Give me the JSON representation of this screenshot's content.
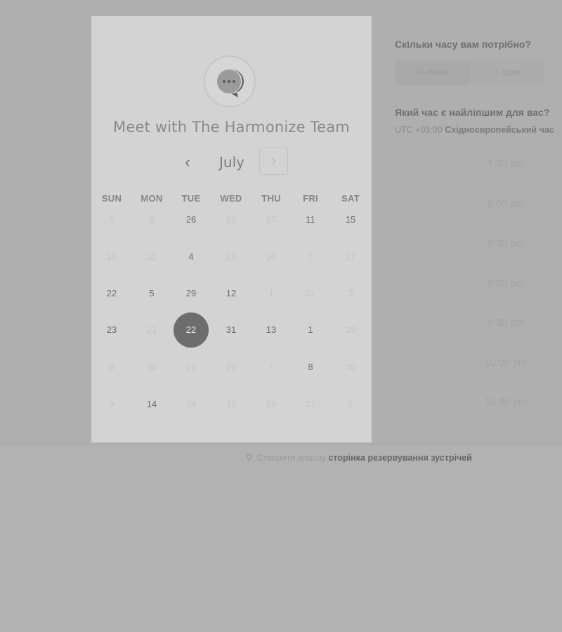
{
  "calendar": {
    "title": "Meet with The Harmonize Team",
    "month": "July",
    "prev_label": "‹",
    "next_label": "›",
    "logo_icon": "chat-bubble-icon",
    "weekdays": [
      "SUN",
      "MON",
      "TUE",
      "WED",
      "THU",
      "FRI",
      "SAT"
    ],
    "weeks": [
      [
        {
          "d": "5",
          "on": false
        },
        {
          "d": "8",
          "on": false
        },
        {
          "d": "26",
          "on": true
        },
        {
          "d": "10",
          "on": false
        },
        {
          "d": "27",
          "on": false
        },
        {
          "d": "11",
          "on": true
        },
        {
          "d": "15",
          "on": true
        }
      ],
      [
        {
          "d": "18",
          "on": false
        },
        {
          "d": "11",
          "on": false
        },
        {
          "d": "4",
          "on": true
        },
        {
          "d": "21",
          "on": false
        },
        {
          "d": "20",
          "on": false
        },
        {
          "d": "7",
          "on": false
        },
        {
          "d": "17",
          "on": false
        }
      ],
      [
        {
          "d": "22",
          "on": true
        },
        {
          "d": "5",
          "on": true
        },
        {
          "d": "29",
          "on": true
        },
        {
          "d": "12",
          "on": true
        },
        {
          "d": "1",
          "on": false
        },
        {
          "d": "11",
          "on": false
        },
        {
          "d": "3",
          "on": false
        }
      ],
      [
        {
          "d": "23",
          "on": true
        },
        {
          "d": "21",
          "on": false
        },
        {
          "d": "22",
          "on": true,
          "selected": true
        },
        {
          "d": "31",
          "on": true
        },
        {
          "d": "13",
          "on": true
        },
        {
          "d": "1",
          "on": true
        },
        {
          "d": "29",
          "on": false
        }
      ],
      [
        {
          "d": "8",
          "on": false
        },
        {
          "d": "30",
          "on": false
        },
        {
          "d": "21",
          "on": false
        },
        {
          "d": "28",
          "on": false
        },
        {
          "d": "7",
          "on": false
        },
        {
          "d": "8",
          "on": true
        },
        {
          "d": "30",
          "on": false
        }
      ],
      [
        {
          "d": "9",
          "on": false
        },
        {
          "d": "14",
          "on": true
        },
        {
          "d": "24",
          "on": false
        },
        {
          "d": "12",
          "on": false
        },
        {
          "d": "18",
          "on": false
        },
        {
          "d": "27",
          "on": false
        },
        {
          "d": "2",
          "on": false
        }
      ]
    ]
  },
  "duration": {
    "question": "Скільки часу вам потрібно?",
    "options": [
      "30 хвилин",
      "1 годин"
    ],
    "active_index": 0
  },
  "time": {
    "question": "Який час є найліпшим для вас?",
    "tz_offset": "UTC +03:00",
    "tz_name": "Східноєвропейський час",
    "slots": [
      "7:30 pm",
      "8:00 pm",
      "8:30 pm",
      "9:00 pm",
      "9:30 pm",
      "10:00 pm",
      "10:30 pm"
    ]
  },
  "footer": {
    "icon": "sprocket-icon",
    "prefix": "Створити власну",
    "link": "сторінка резервування зустрічей"
  },
  "colors": {
    "page_background": "#b2b2b2",
    "card_background": "#d3d3d3",
    "selected_day": "#6d6d6d"
  }
}
